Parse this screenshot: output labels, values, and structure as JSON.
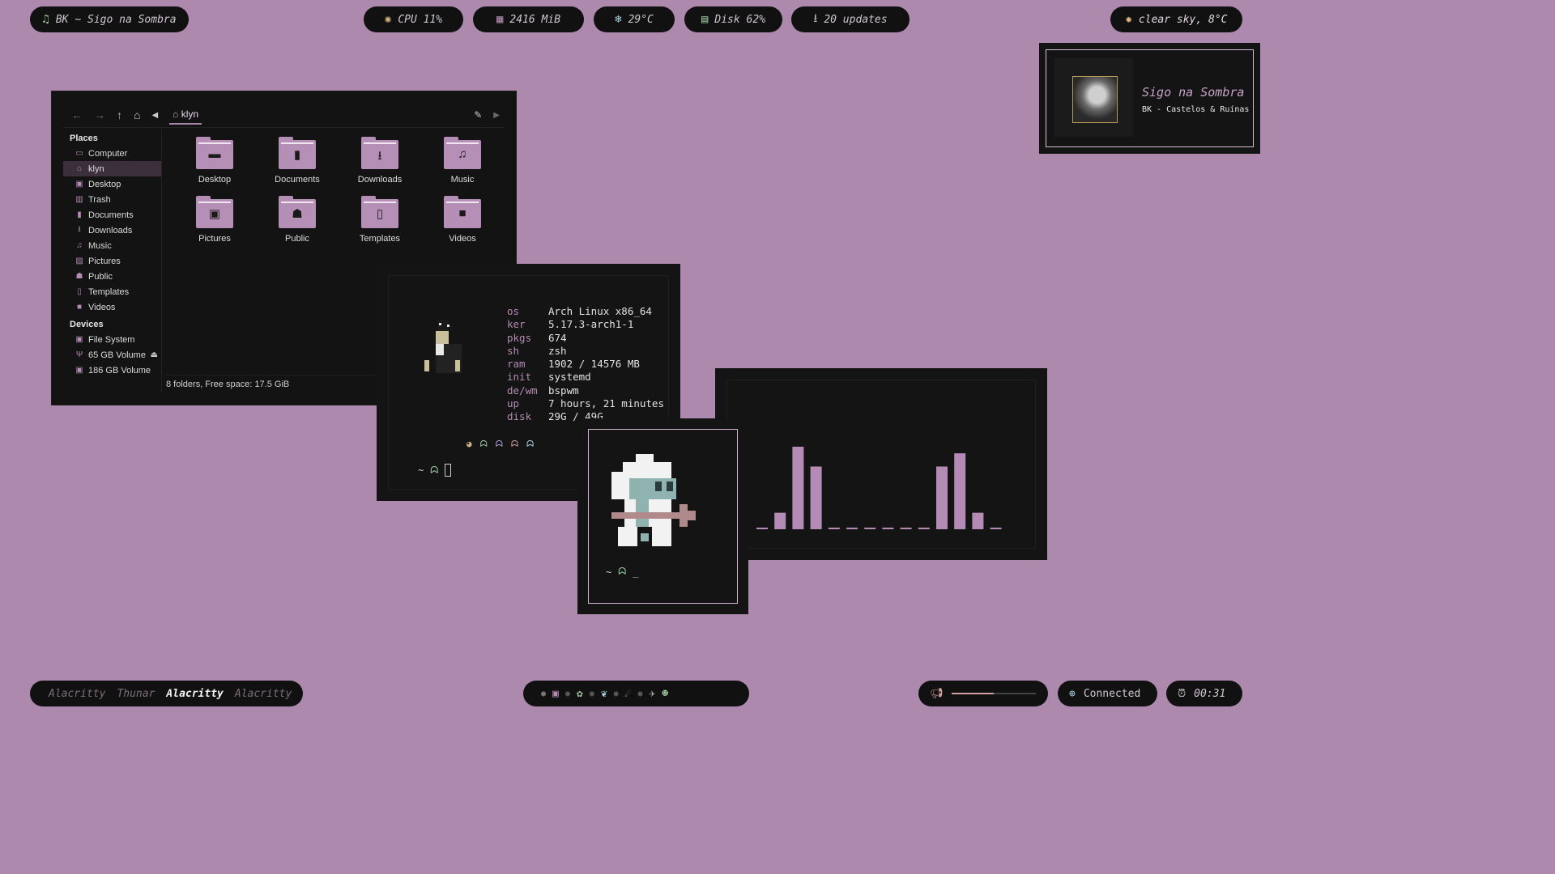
{
  "topbar": {
    "now_playing": {
      "icon": "music-note-icon",
      "text": "BK ~ Sigo na Sombra"
    },
    "cpu": {
      "icon": "cpu-icon",
      "text": "CPU 11%"
    },
    "mem": {
      "icon": "memory-icon",
      "text": "2416 MiB"
    },
    "temp": {
      "icon": "snowflake-icon",
      "text": "29°C"
    },
    "disk": {
      "icon": "disk-icon",
      "text": "Disk 62%"
    },
    "updates": {
      "icon": "download-icon",
      "text": "20 updates"
    },
    "weather": {
      "icon": "sun-icon",
      "text": "clear sky, 8°C"
    }
  },
  "filemanager": {
    "crumb": "klyn",
    "places_header": "Places",
    "places": [
      {
        "label": "Computer",
        "icon": "computer-icon"
      },
      {
        "label": "klyn",
        "icon": "home-icon",
        "selected": true
      },
      {
        "label": "Desktop",
        "icon": "desktop-icon"
      },
      {
        "label": "Trash",
        "icon": "trash-icon"
      },
      {
        "label": "Documents",
        "icon": "documents-icon"
      },
      {
        "label": "Downloads",
        "icon": "downloads-icon"
      },
      {
        "label": "Music",
        "icon": "music-icon"
      },
      {
        "label": "Pictures",
        "icon": "pictures-icon"
      },
      {
        "label": "Public",
        "icon": "public-icon"
      },
      {
        "label": "Templates",
        "icon": "templates-icon"
      },
      {
        "label": "Videos",
        "icon": "videos-icon"
      }
    ],
    "devices_header": "Devices",
    "devices": [
      {
        "label": "File System",
        "icon": "drive-icon"
      },
      {
        "label": "65 GB Volume",
        "icon": "usb-icon",
        "eject": true
      },
      {
        "label": "186 GB Volume",
        "icon": "drive-icon"
      }
    ],
    "folders": [
      {
        "label": "Desktop",
        "glyph": "▬"
      },
      {
        "label": "Documents",
        "glyph": "▮"
      },
      {
        "label": "Downloads",
        "glyph": "⭳"
      },
      {
        "label": "Music",
        "glyph": "♫"
      },
      {
        "label": "Pictures",
        "glyph": "▣"
      },
      {
        "label": "Public",
        "glyph": "☗"
      },
      {
        "label": "Templates",
        "glyph": "▯"
      },
      {
        "label": "Videos",
        "glyph": "■"
      }
    ],
    "status": "8 folders, Free space: 17.5 GiB"
  },
  "fetch": [
    {
      "k": "os",
      "v": "Arch Linux x86_64"
    },
    {
      "k": "ker",
      "v": "5.17.3-arch1-1"
    },
    {
      "k": "pkgs",
      "v": "674"
    },
    {
      "k": "sh",
      "v": "zsh"
    },
    {
      "k": "ram",
      "v": "1902 / 14576 MB"
    },
    {
      "k": "init",
      "v": "systemd"
    },
    {
      "k": "de/wm",
      "v": "bspwm"
    },
    {
      "k": "up",
      "v": "7 hours, 21 minutes"
    },
    {
      "k": "disk",
      "v": "29G / 49G"
    }
  ],
  "prompt": "~",
  "visualizer": {
    "levels": [
      0.02,
      0.2,
      1.0,
      0.76,
      0.02,
      0.02,
      0.02,
      0.02,
      0.02,
      0.02,
      0.76,
      0.92,
      0.2,
      0.02
    ]
  },
  "music": {
    "title": "Sigo na Sombra",
    "subtitle": "BK - Castelos & Ruínas"
  },
  "taskbar": {
    "windows": [
      {
        "label": "Alacritty",
        "active": false
      },
      {
        "label": "Thunar",
        "active": false
      },
      {
        "label": "Alacritty",
        "active": true
      },
      {
        "label": "Alacritty",
        "active": false
      }
    ],
    "volume_level": 0.5,
    "network": "Connected",
    "clock": "00:31"
  },
  "colors": {
    "accent": "#b48bb4",
    "bar": "#111112",
    "bg": "#ad8aad"
  }
}
